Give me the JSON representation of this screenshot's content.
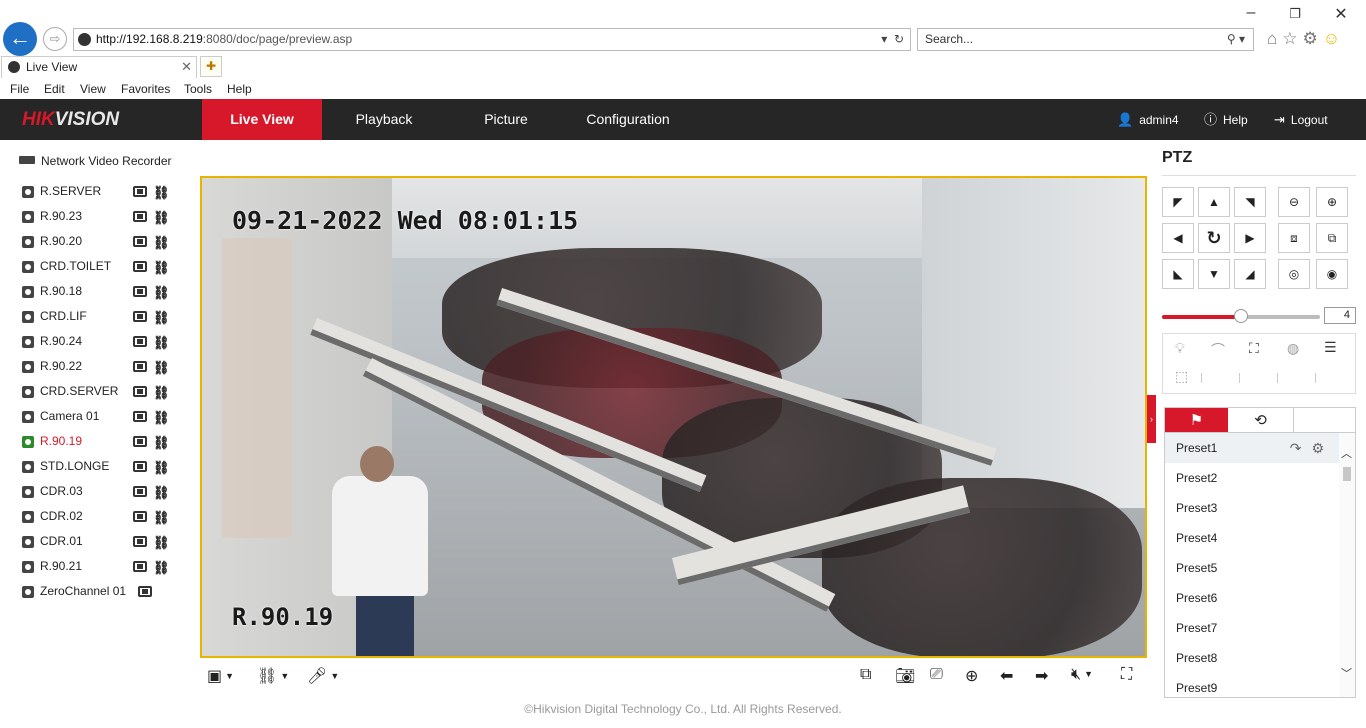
{
  "browser": {
    "url_host": "http://192.168.8.219",
    "url_rest": ":8080/doc/page/preview.asp",
    "search_placeholder": "Search...",
    "tab_title": "Live View",
    "menu": [
      "File",
      "Edit",
      "View",
      "Favorites",
      "Tools",
      "Help"
    ]
  },
  "header": {
    "logo_red": "HIK",
    "logo_white": "VISION",
    "tabs": [
      "Live View",
      "Playback",
      "Picture",
      "Configuration"
    ],
    "active_tab": "Live View",
    "user": "admin4",
    "help": "Help",
    "logout": "Logout"
  },
  "tree": {
    "root": "Network Video Recorder",
    "cameras": [
      "R.SERVER",
      "R.90.23",
      "R.90.20",
      "CRD.TOILET",
      "R.90.18",
      "CRD.LIF",
      "R.90.24",
      "R.90.22",
      "CRD.SERVER",
      "Camera 01",
      "R.90.19",
      "STD.LONGE",
      "CDR.03",
      "CDR.02",
      "CDR.01",
      "R.90.21",
      "ZeroChannel 01"
    ],
    "active_camera": "R.90.19"
  },
  "video": {
    "timestamp": "09-21-2022 Wed 08:01:15",
    "camera_label": "R.90.19"
  },
  "ptz": {
    "title": "PTZ",
    "speed": "4",
    "speed_fraction": 0.5,
    "presets": [
      "Preset1",
      "Preset2",
      "Preset3",
      "Preset4",
      "Preset5",
      "Preset6",
      "Preset7",
      "Preset8",
      "Preset9"
    ],
    "selected_preset": "Preset1"
  },
  "footer": "©Hikvision Digital Technology Co., Ltd. All Rights Reserved.",
  "colors": {
    "accent": "#d7182a",
    "header_bg": "#262626",
    "video_border": "#e8b400"
  }
}
